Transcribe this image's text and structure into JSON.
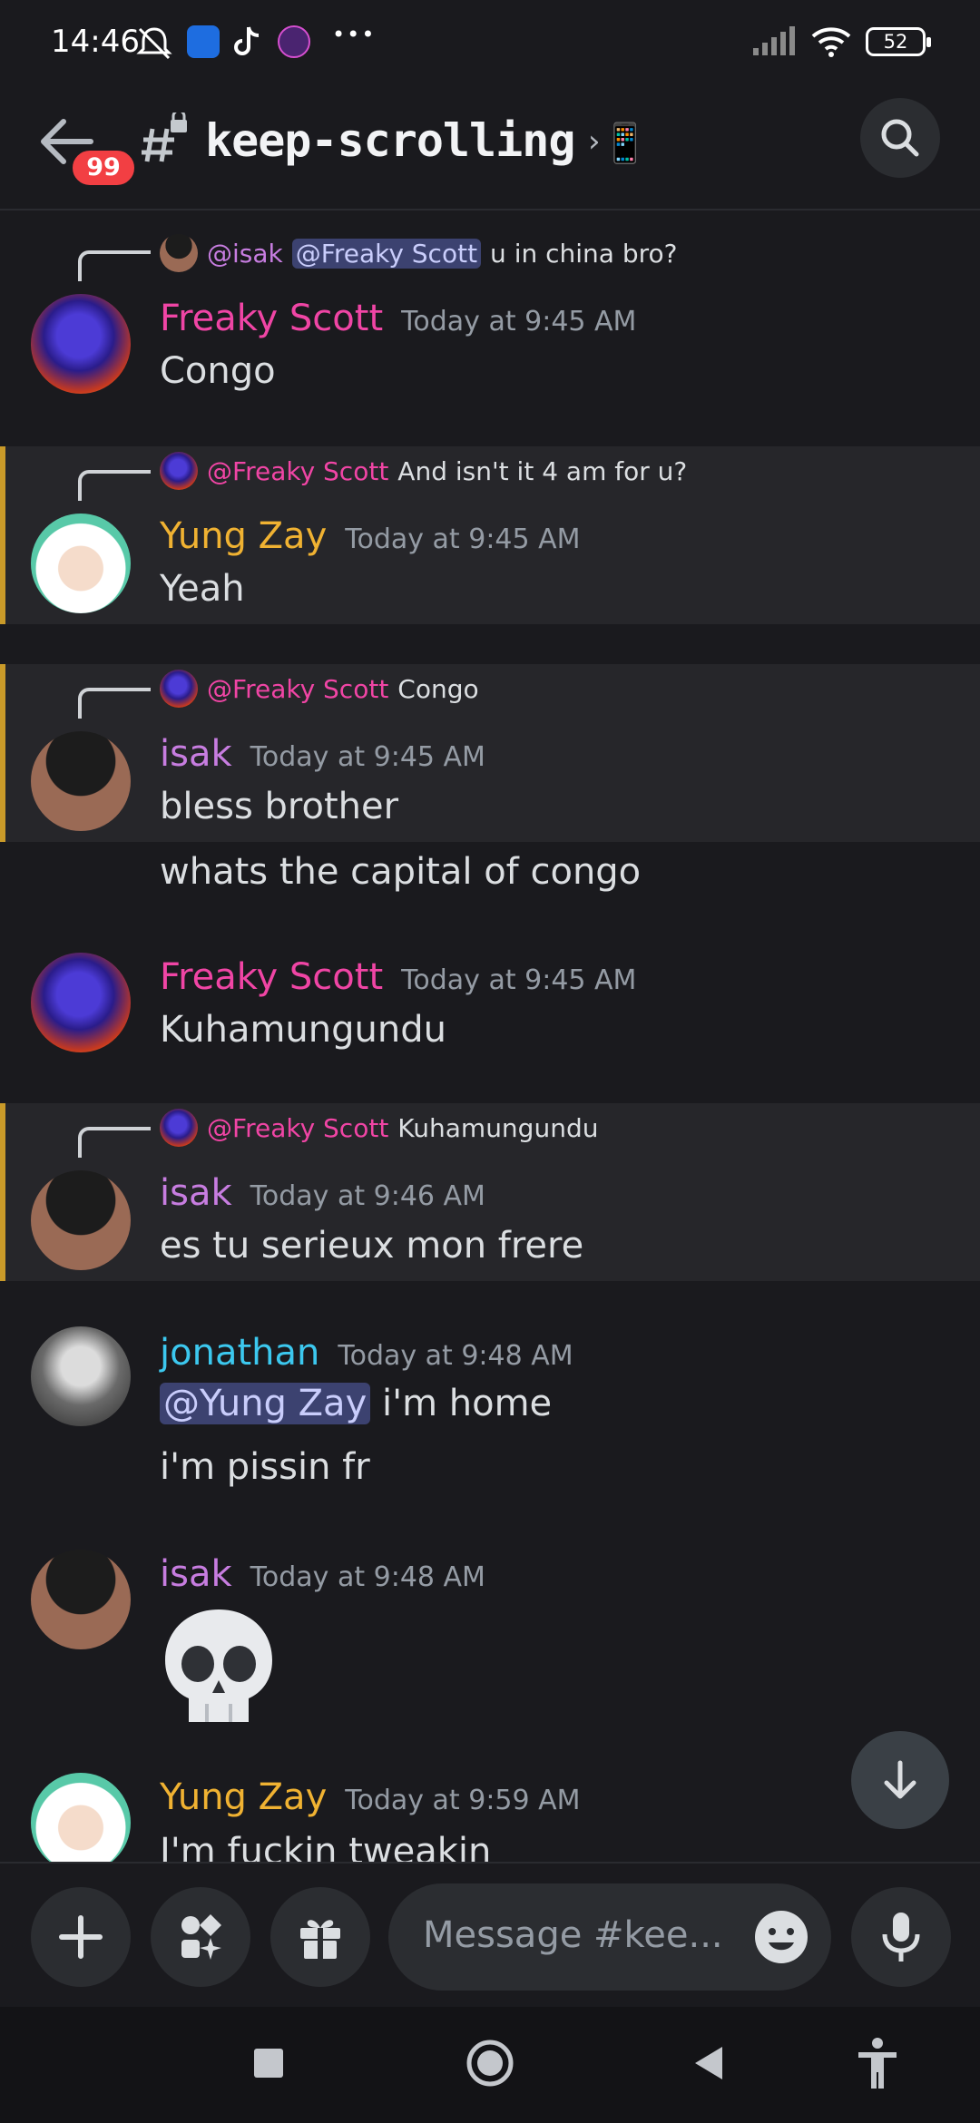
{
  "status_bar": {
    "time": "14:46",
    "battery": "52",
    "icons": [
      "mute-bell-icon",
      "app-icon",
      "tiktok-icon",
      "app-icon",
      "more-dots-icon",
      "signal-icon",
      "wifi-icon",
      "battery-icon"
    ],
    "more": "•••"
  },
  "header": {
    "unread_badge": "99",
    "channel_name": "keep-scrolling",
    "channel_emoji": "📱",
    "chevron": "›"
  },
  "messages": [
    {
      "reply": {
        "author": "@isak",
        "mention": "@Freaky Scott",
        "text": "u in china bro?"
      },
      "author": "Freaky Scott",
      "time": "Today at 9:45 AM",
      "lines": [
        "Congo"
      ]
    },
    {
      "reply": {
        "author": "@Freaky Scott",
        "text": "And isn't it 4 am for u?"
      },
      "author": "Yung Zay",
      "time": "Today at 9:45 AM",
      "lines": [
        "Yeah"
      ]
    },
    {
      "reply": {
        "author": "@Freaky Scott",
        "text": "Congo"
      },
      "author": "isak",
      "time": "Today at 9:45 AM",
      "lines": [
        "bless brother",
        "whats the capital of congo"
      ]
    },
    {
      "author": "Freaky Scott",
      "time": "Today at 9:45 AM",
      "lines": [
        "Kuhamungundu"
      ]
    },
    {
      "reply": {
        "author": "@Freaky Scott",
        "text": "Kuhamungundu"
      },
      "author": "isak",
      "time": "Today at 9:46 AM",
      "lines": [
        "es tu serieux mon frere"
      ]
    },
    {
      "author": "jonathan",
      "time": "Today at 9:48 AM",
      "mention": "@Yung Zay",
      "lines": [
        "i'm home",
        "i'm pissin fr"
      ]
    },
    {
      "author": "isak",
      "time": "Today at 9:48 AM",
      "emoji": "skull"
    },
    {
      "author": "Yung Zay",
      "time": "Today at 9:59 AM",
      "lines": [
        "I'm fuckin tweakin"
      ]
    }
  ],
  "composer": {
    "placeholder": "Message #kee..."
  }
}
